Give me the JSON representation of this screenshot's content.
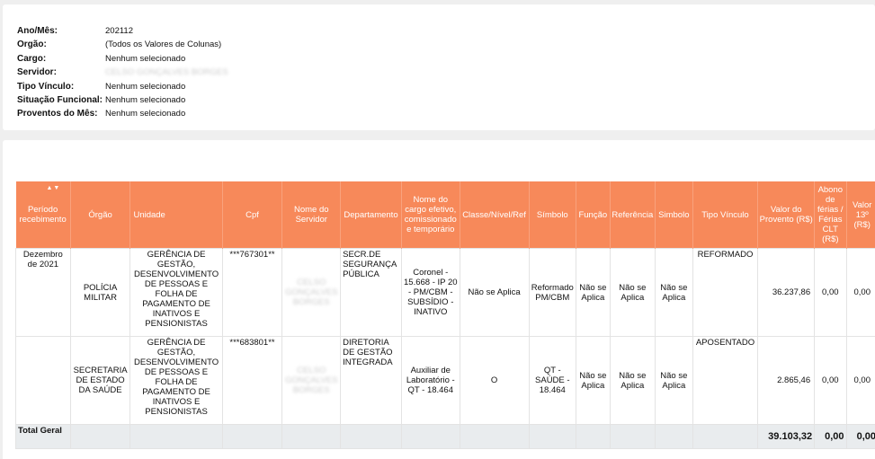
{
  "filters": [
    {
      "label": "Ano/Mês:",
      "value": "202112",
      "blurred": false
    },
    {
      "label": "Orgão:",
      "value": "(Todos os Valores de Colunas)",
      "blurred": false
    },
    {
      "label": "Cargo:",
      "value": "Nenhum selecionado",
      "blurred": false
    },
    {
      "label": "Servidor:",
      "value": "CELSO GONÇALVES BORGES",
      "blurred": true
    },
    {
      "label": "Tipo Vínculo:",
      "value": "Nenhum selecionado",
      "blurred": false
    },
    {
      "label": "Situação Funcional:",
      "value": "Nenhum selecionado",
      "blurred": false
    },
    {
      "label": "Proventos do Mês:",
      "value": "Nenhum selecionado",
      "blurred": false
    }
  ],
  "table": {
    "headers": {
      "periodo": "Período recebimento",
      "orgao": "Órgão",
      "unidade": "Unidade",
      "cpf": "Cpf",
      "nome": "Nome do Servidor",
      "departamento": "Departamento",
      "cargo": "Nome do cargo efetivo, comissionado e temporário",
      "classe": "Classe/Nível/Ref",
      "simbolo": "Símbolo",
      "funcao": "Função",
      "referencia": "Referência",
      "simbolo2": "Simbolo",
      "tipo_vinculo": "Tipo Vínculo",
      "valor_provento": "Valor do Provento (R$)",
      "abono": "Abono de férias / Férias CLT (R$)",
      "valor13": "Valor 13º (R$)"
    },
    "rows": [
      {
        "periodo": "Dezembro de 2021",
        "orgao": "POLÍCIA MILITAR",
        "unidade": "GERÊNCIA DE GESTÃO, DESENVOLVIMENTO DE PESSOAS E FOLHA DE PAGAMENTO DE INATIVOS E PENSIONISTAS",
        "cpf": "***767301**",
        "nome": "CELSO GONÇALVES BORGES",
        "departamento": "SECR.DE SEGURANÇA PÚBLICA",
        "cargo": "Coronel - 15.668 - IP 20 - PM/CBM - SUBSÍDIO - INATIVO",
        "classe": "Não se Aplica",
        "simbolo": "Reformado PM/CBM",
        "funcao": "Não se Aplica",
        "referencia": "Não se Aplica",
        "simbolo2": "Não se Aplica",
        "tipo_vinculo": "REFORMADO",
        "valor_provento": "36.237,86",
        "abono": "0,00",
        "valor13": "0,00"
      },
      {
        "periodo": "",
        "orgao": "SECRETARIA DE ESTADO DA SAÚDE",
        "unidade": "GERÊNCIA DE GESTÃO, DESENVOLVIMENTO DE PESSOAS E FOLHA DE PAGAMENTO DE INATIVOS E PENSIONISTAS",
        "cpf": "***683801**",
        "nome": "CELSO GONÇALVES BORGES",
        "departamento": "DIRETORIA DE GESTÃO INTEGRADA",
        "cargo": "Auxiliar de Laboratório - QT - 18.464",
        "classe": "O",
        "simbolo": "QT - SAÚDE - 18.464",
        "funcao": "Não se Aplica",
        "referencia": "Não se Aplica",
        "simbolo2": "Não se Aplica",
        "tipo_vinculo": "APOSENTADO",
        "valor_provento": "2.865,46",
        "abono": "0,00",
        "valor13": "0,00"
      }
    ],
    "total": {
      "label": "Total Geral",
      "valor_provento": "39.103,32",
      "abono": "0,00",
      "valor13": "0,00"
    }
  },
  "icons": {
    "sort": "sort-arrows-icon"
  },
  "colors": {
    "header_bg": "#f7895a",
    "total_bg": "#e9ecee"
  }
}
